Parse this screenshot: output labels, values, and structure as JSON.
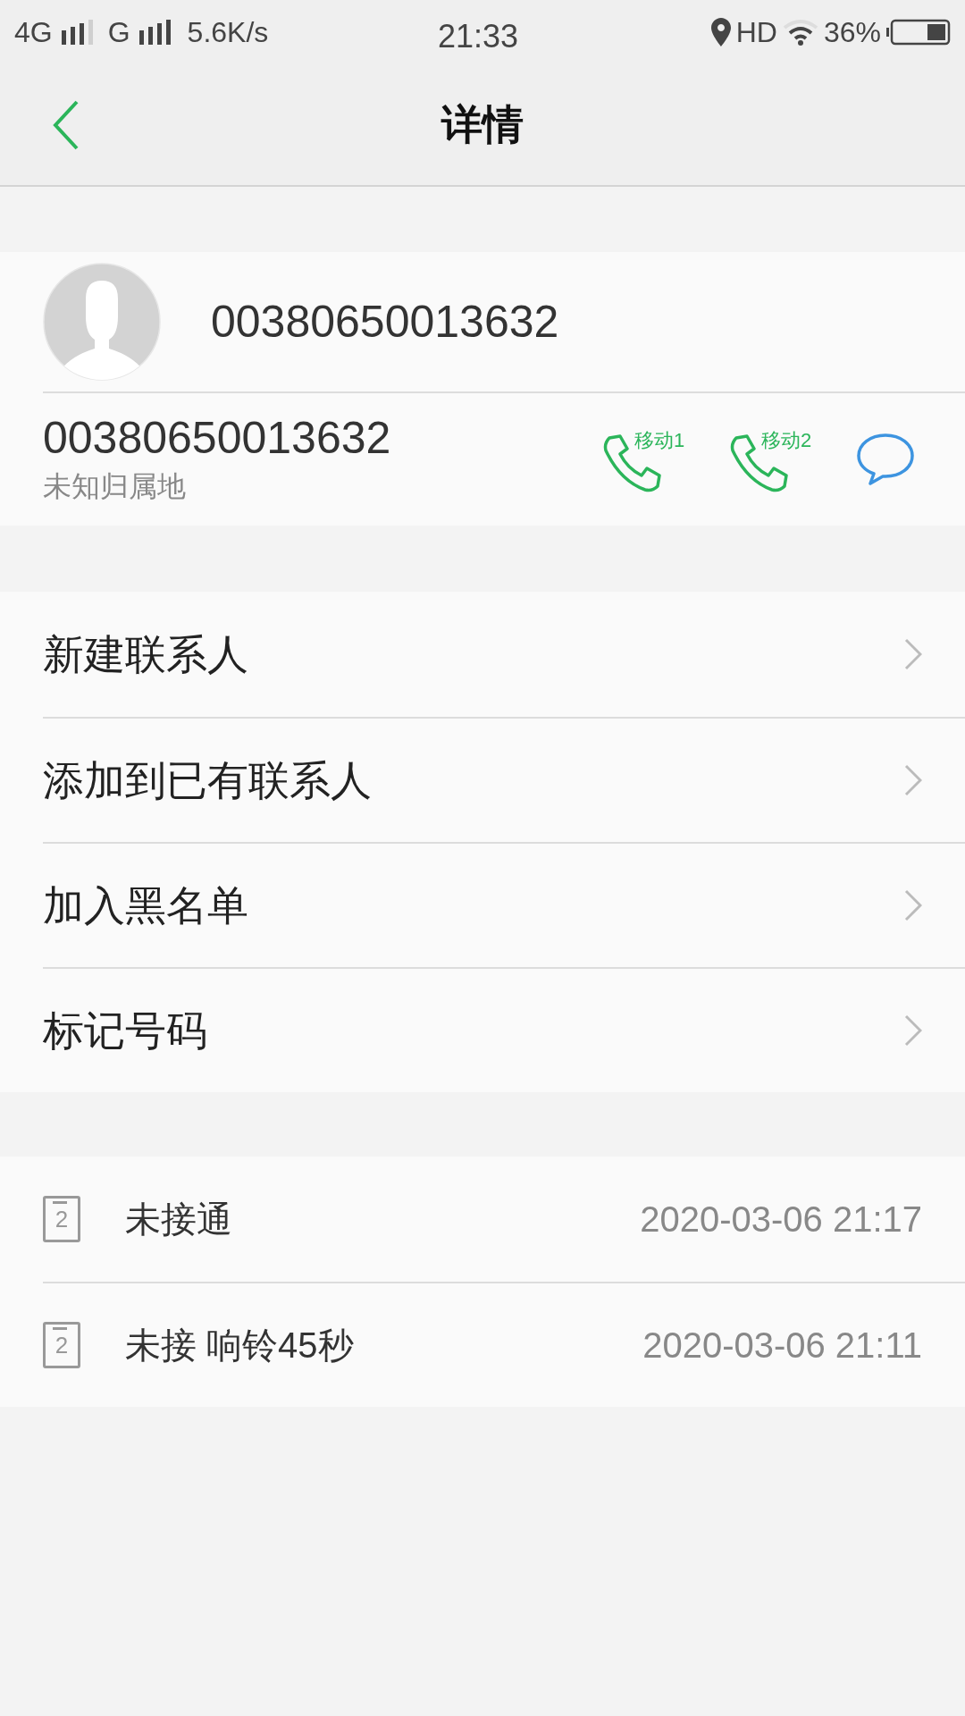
{
  "status_bar": {
    "network_1": "4G",
    "network_2": "G",
    "speed": "5.6K/s",
    "time": "21:33",
    "hd": "HD",
    "battery": "36%"
  },
  "header": {
    "title": "详情"
  },
  "contact": {
    "name": "00380650013632",
    "number": "00380650013632",
    "location": "未知归属地",
    "actions": [
      {
        "kind": "call",
        "label": "移动1"
      },
      {
        "kind": "call",
        "label": "移动2"
      },
      {
        "kind": "message"
      }
    ]
  },
  "menu": [
    {
      "label": "新建联系人"
    },
    {
      "label": "添加到已有联系人"
    },
    {
      "label": "加入黑名单"
    },
    {
      "label": "标记号码"
    }
  ],
  "call_log": [
    {
      "sim": "2",
      "status": "未接通",
      "time": "2020-03-06 21:17"
    },
    {
      "sim": "2",
      "status": "未接 响铃45秒",
      "time": "2020-03-06 21:11"
    }
  ]
}
